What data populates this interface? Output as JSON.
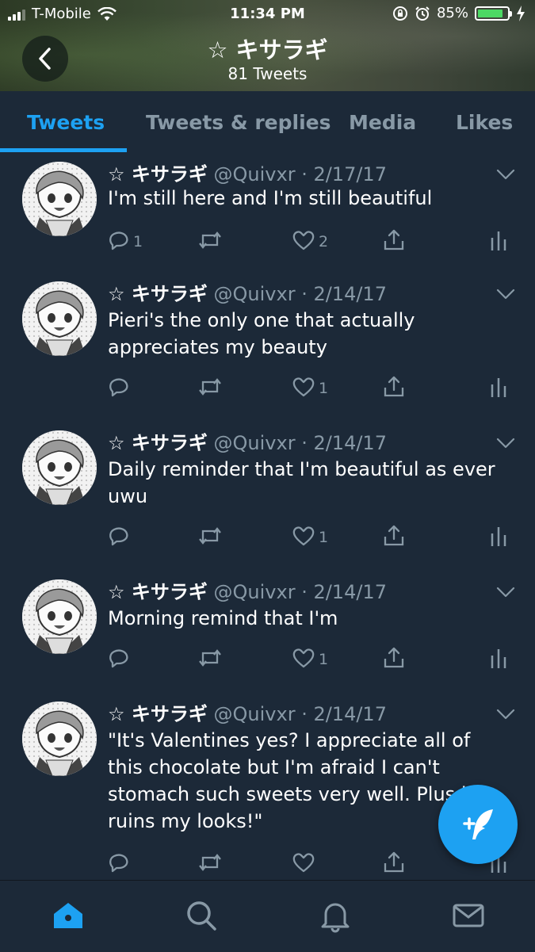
{
  "status_bar": {
    "carrier": "T-Mobile",
    "time": "11:34 PM",
    "battery_percent": "85%",
    "battery_level": 0.85
  },
  "header": {
    "title": "☆ キサラギ",
    "subtitle": "81 Tweets"
  },
  "tabs": [
    {
      "label": "Tweets",
      "active": true
    },
    {
      "label": "Tweets & replies",
      "active": false
    },
    {
      "label": "Media",
      "active": false
    },
    {
      "label": "Likes",
      "active": false
    }
  ],
  "tweets": [
    {
      "name": "☆ キサラギ",
      "meta": "@Quivxr · 2/17/17",
      "text": "I'm still here and I'm still beautiful",
      "reply_count": "1",
      "retweet_count": "",
      "like_count": "2"
    },
    {
      "name": "☆ キサラギ",
      "meta": "@Quivxr · 2/14/17",
      "text": "Pieri's the only one that actually appreciates my beauty",
      "reply_count": "",
      "retweet_count": "",
      "like_count": "1"
    },
    {
      "name": "☆ キサラギ",
      "meta": "@Quivxr · 2/14/17",
      "text": "Daily reminder that I'm beautiful as ever uwu",
      "reply_count": "",
      "retweet_count": "",
      "like_count": "1"
    },
    {
      "name": "☆ キサラギ",
      "meta": "@Quivxr · 2/14/17",
      "text": "Morning remind that I'm",
      "reply_count": "",
      "retweet_count": "",
      "like_count": "1"
    },
    {
      "name": "☆ キサラギ",
      "meta": "@Quivxr · 2/14/17",
      "text": "\"It's Valentines yes? I appreciate all of this chocolate but I'm afraid I can't stomach such sweets very well. Plus it ruins my looks!\"",
      "reply_count": "",
      "retweet_count": "",
      "like_count": ""
    }
  ],
  "icons": {
    "back": "chevron-left-icon",
    "reply": "reply-icon",
    "retweet": "retweet-icon",
    "like": "heart-icon",
    "share": "share-icon",
    "analytics": "analytics-icon",
    "compose": "compose-tweet-icon",
    "nav": [
      "home-icon",
      "search-icon",
      "notifications-icon",
      "messages-icon"
    ]
  },
  "colors": {
    "accent": "#1da1f2",
    "background": "#1c2938",
    "muted": "#8899a6"
  }
}
